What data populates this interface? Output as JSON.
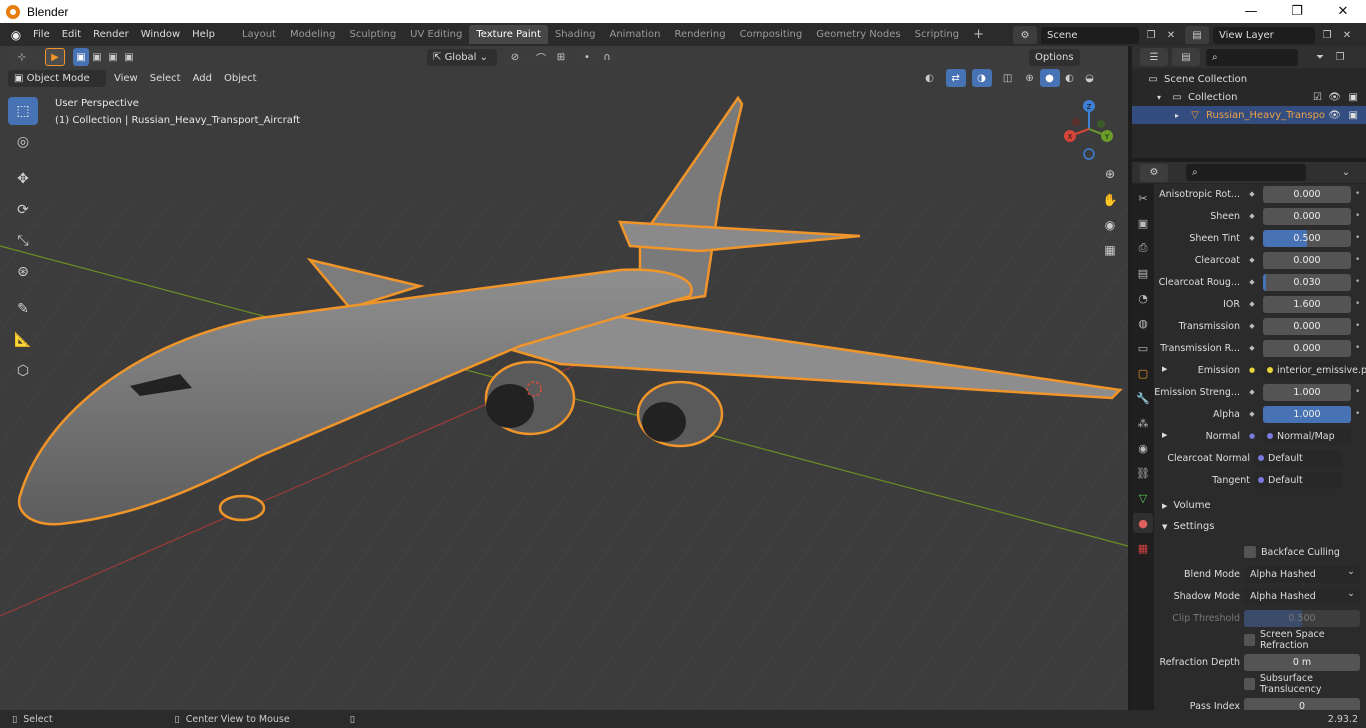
{
  "window": {
    "title": "Blender",
    "minimize": "—",
    "maximize": "❐",
    "close": "✕"
  },
  "menu": [
    "File",
    "Edit",
    "Render",
    "Window",
    "Help"
  ],
  "workspaces": [
    "Layout",
    "Modeling",
    "Sculpting",
    "UV Editing",
    "Texture Paint",
    "Shading",
    "Animation",
    "Rendering",
    "Compositing",
    "Geometry Nodes",
    "Scripting"
  ],
  "active_workspace": "Texture Paint",
  "add_workspace": "+",
  "scene": {
    "name": "Scene",
    "view_layer": "View Layer"
  },
  "viewport": {
    "transform_orientation": "Global",
    "options_label": "Options",
    "mode": "Object Mode",
    "menus": [
      "View",
      "Select",
      "Add",
      "Object"
    ],
    "info_perspective": "User Perspective",
    "info_object": "(1) Collection | Russian_Heavy_Transport_Aircraft",
    "gizmo_axes": {
      "x": "X",
      "y": "Y",
      "z": "Z"
    }
  },
  "outliner": {
    "rows": [
      {
        "label": "Scene Collection"
      },
      {
        "label": "Collection"
      },
      {
        "label": "Russian_Heavy_Transpo"
      }
    ]
  },
  "properties": {
    "rows": [
      {
        "label": "Anisotropic Rot...",
        "value": "0.000",
        "fill": 0
      },
      {
        "label": "Sheen",
        "value": "0.000",
        "fill": 0
      },
      {
        "label": "Sheen Tint",
        "value": "0.500",
        "fill": 0.5
      },
      {
        "label": "Clearcoat",
        "value": "0.000",
        "fill": 0
      },
      {
        "label": "Clearcoat Roug...",
        "value": "0.030",
        "fill": 0.03
      },
      {
        "label": "IOR",
        "value": "1.600",
        "fill": 0
      },
      {
        "label": "Transmission",
        "value": "0.000",
        "fill": 0
      },
      {
        "label": "Transmission R...",
        "value": "0.000",
        "fill": 0
      }
    ],
    "emission": {
      "label": "Emission",
      "value": "interior_emissive.png"
    },
    "emission_strength": {
      "label": "Emission Streng...",
      "value": "1.000"
    },
    "alpha": {
      "label": "Alpha",
      "value": "1.000",
      "fill": 1
    },
    "normal": {
      "label": "Normal",
      "value": "Normal/Map"
    },
    "clearcoat_normal": {
      "label": "Clearcoat Normal",
      "value": "Default"
    },
    "tangent": {
      "label": "Tangent",
      "value": "Default"
    },
    "sections": {
      "volume": "Volume",
      "settings": "Settings"
    },
    "settings": {
      "backface_culling": "Backface Culling",
      "blend_mode_label": "Blend Mode",
      "blend_mode": "Alpha Hashed",
      "shadow_mode_label": "Shadow Mode",
      "shadow_mode": "Alpha Hashed",
      "clip_threshold_label": "Clip Threshold",
      "clip_threshold": "0.500",
      "screen_space_refraction": "Screen Space Refraction",
      "refraction_depth_label": "Refraction Depth",
      "refraction_depth": "0 m",
      "subsurface_translucency": "Subsurface Translucency",
      "pass_index_label": "Pass Index",
      "pass_index": "0"
    }
  },
  "status": {
    "select": "Select",
    "center_view": "Center View to Mouse",
    "version": "2.93.2"
  },
  "colors": {
    "accent": "#4772b3",
    "selection_outline": "#f0952a",
    "viewport_bg": "#3c3c3c"
  }
}
